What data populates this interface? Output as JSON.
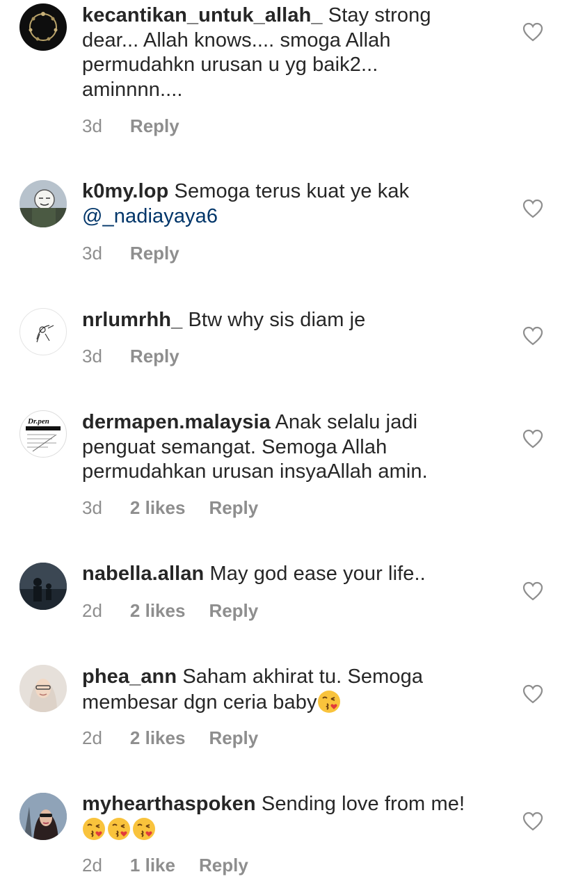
{
  "comments": [
    {
      "username": "kecantikan_untuk_allah_",
      "text": "Stay strong dear... Allah knows.... smoga Allah permudahkn urusan u yg baik2... aminnnn....",
      "time": "3d",
      "likes": "",
      "reply": "Reply"
    },
    {
      "username": "k0my.lop",
      "text": "Semoga terus kuat ye kak",
      "mention": "@_nadiayaya6",
      "time": "3d",
      "likes": "",
      "reply": "Reply"
    },
    {
      "username": "nrlumrhh_",
      "text": "Btw why sis diam je",
      "time": "3d",
      "likes": "",
      "reply": "Reply"
    },
    {
      "username": "dermapen.malaysia",
      "text": "Anak selalu jadi penguat semangat. Semoga Allah permudahkan urusan insyaAllah amin.",
      "avatar_text": "Dr.pen",
      "time": "3d",
      "likes": "2 likes",
      "reply": "Reply"
    },
    {
      "username": "nabella.allan",
      "text": "May god ease your life..",
      "time": "2d",
      "likes": "2 likes",
      "reply": "Reply"
    },
    {
      "username": "phea_ann",
      "text": "Saham akhirat tu. Semoga membesar dgn ceria baby",
      "time": "2d",
      "likes": "2 likes",
      "reply": "Reply"
    },
    {
      "username": "myhearthaspoken",
      "text": "Sending love from me!",
      "time": "2d",
      "likes": "1 like",
      "reply": "Reply"
    }
  ],
  "icons": {
    "like": "heart-outline-icon",
    "emoji": "face-blowing-kiss-emoji"
  },
  "colors": {
    "text": "#262626",
    "meta": "#8e8e8e",
    "mention": "#003569",
    "heart": "#8e8e8e"
  }
}
